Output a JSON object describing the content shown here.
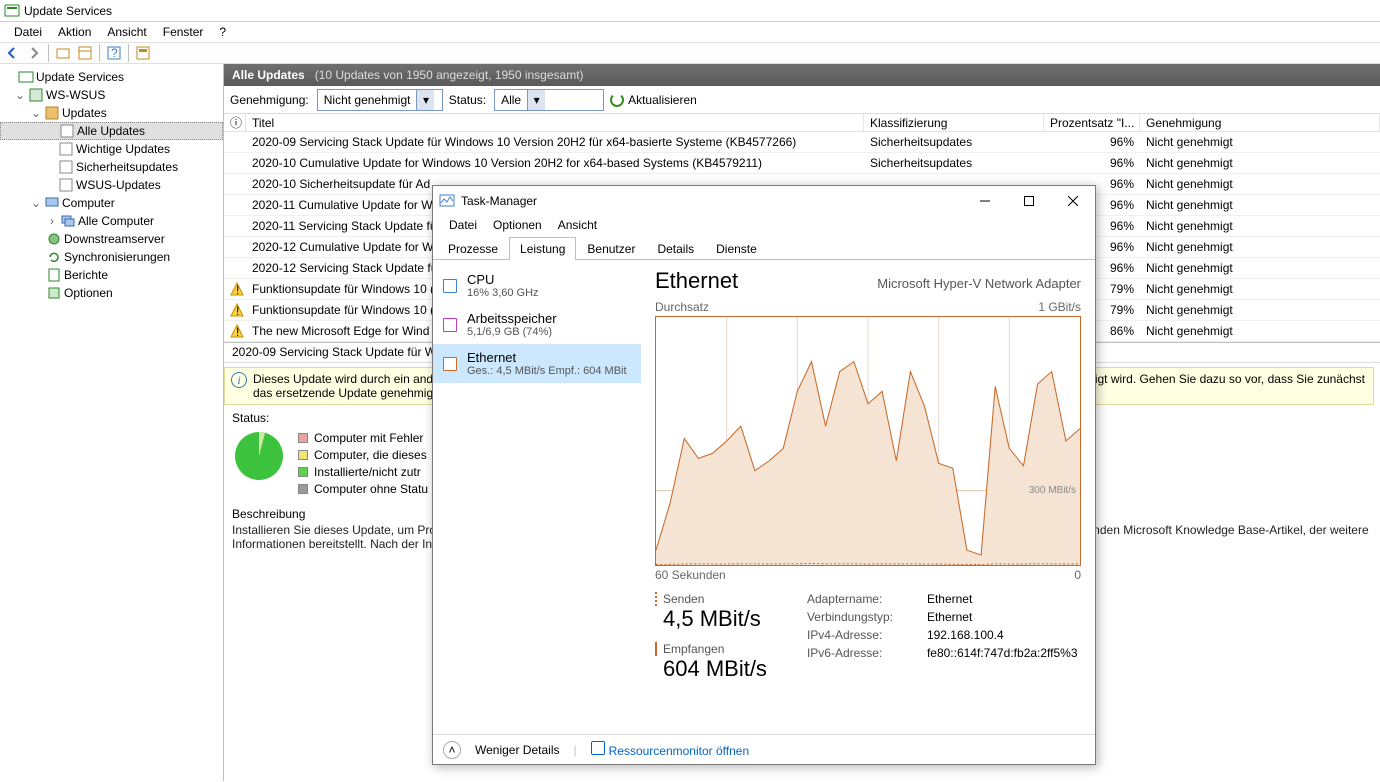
{
  "app": {
    "title": "Update Services"
  },
  "menubar": [
    "Datei",
    "Aktion",
    "Ansicht",
    "Fenster",
    "?"
  ],
  "tree": {
    "root": "Update Services",
    "server": "WS-WSUS",
    "updates": "Updates",
    "updates_children": [
      "Alle Updates",
      "Wichtige Updates",
      "Sicherheitsupdates",
      "WSUS-Updates"
    ],
    "computer": "Computer",
    "computer_children": [
      "Alle Computer"
    ],
    "other": [
      "Downstreamserver",
      "Synchronisierungen",
      "Berichte",
      "Optionen"
    ]
  },
  "content_header": {
    "title": "Alle Updates",
    "summary": "(10 Updates von 1950 angezeigt, 1950 insgesamt)"
  },
  "filter": {
    "approval_label": "Genehmigung:",
    "approval_value": "Nicht genehmigt",
    "status_label": "Status:",
    "status_value": "Alle",
    "refresh": "Aktualisieren"
  },
  "columns": [
    "",
    "Titel",
    "Klassifizierung",
    "Prozentsatz \"I...",
    "Genehmigung"
  ],
  "rows": [
    {
      "warn": false,
      "title": "2020-09 Servicing Stack Update für Windows 10 Version 20H2 für x64-basierte Systeme (KB4577266)",
      "class": "Sicherheitsupdates",
      "pct": "96%",
      "appr": "Nicht genehmigt"
    },
    {
      "warn": false,
      "title": "2020-10 Cumulative Update for Windows 10 Version 20H2 for x64-based Systems (KB4579211)",
      "class": "Sicherheitsupdates",
      "pct": "96%",
      "appr": "Nicht genehmigt"
    },
    {
      "warn": false,
      "title": "2020-10 Sicherheitsupdate für Ad",
      "class": "",
      "pct": "96%",
      "appr": "Nicht genehmigt"
    },
    {
      "warn": false,
      "title": "2020-11 Cumulative Update for W",
      "class": "",
      "pct": "96%",
      "appr": "Nicht genehmigt"
    },
    {
      "warn": false,
      "title": "2020-11 Servicing Stack Update fü",
      "class": "",
      "pct": "96%",
      "appr": "Nicht genehmigt"
    },
    {
      "warn": false,
      "title": "2020-12 Cumulative Update for W",
      "class": "",
      "pct": "96%",
      "appr": "Nicht genehmigt"
    },
    {
      "warn": false,
      "title": "2020-12 Servicing Stack Update fü",
      "class": "",
      "pct": "96%",
      "appr": "Nicht genehmigt"
    },
    {
      "warn": true,
      "title": "Funktionsupdate für Windows 10 (",
      "class": "",
      "pct": "79%",
      "appr": "Nicht genehmigt"
    },
    {
      "warn": true,
      "title": "Funktionsupdate für Windows 10 (",
      "class": "",
      "pct": "79%",
      "appr": "Nicht genehmigt"
    },
    {
      "warn": true,
      "title": "The new Microsoft Edge for Wind",
      "class": "",
      "pct": "86%",
      "appr": "Nicht genehmigt"
    }
  ],
  "detail": {
    "title": "2020-09 Servicing Stack Update für W",
    "info_text_1": "Dieses Update wird durch ein and",
    "info_text_2": "das ersetzende Update genehmig",
    "info_text_right": "igt wird. Gehen Sie dazu so vor, dass Sie zunächst",
    "status_label": "Status:",
    "legend": [
      {
        "color": "#e8a2a2",
        "label": "Computer mit Fehler"
      },
      {
        "color": "#f3e27b",
        "label": "Computer, die dieses"
      },
      {
        "color": "#5bd24b",
        "label": "Installierte/nicht zutr"
      },
      {
        "color": "#9a9a9a",
        "label": "Computer ohne Statu"
      }
    ],
    "desc_head": "Beschreibung",
    "desc_body": "Installieren Sie dieses Update, um Probleme in Windows zu beheben. Eine vollständige Liste der Problembehebungen in diesem Update finden Sie im entsprechenden Microsoft Knowledge Base-Artikel, der weitere Informationen bereitstellt. Nach der Installation dieser Komponente müssen Sie den Computer möglicherweise neu starten."
  },
  "tm": {
    "title": "Task-Manager",
    "menu": [
      "Datei",
      "Optionen",
      "Ansicht"
    ],
    "tabs": [
      "Prozesse",
      "Leistung",
      "Benutzer",
      "Details",
      "Dienste"
    ],
    "active_tab": 1,
    "side": [
      {
        "name": "CPU",
        "sub": "16%  3,60 GHz",
        "color": "#3a82d4"
      },
      {
        "name": "Arbeitsspeicher",
        "sub": "5,1/6,9 GB (74%)",
        "color": "#b93fbf"
      },
      {
        "name": "Ethernet",
        "sub": "Ges.: 4,5 MBit/s  Empf.: 604 MBit",
        "color": "#c86a2a"
      }
    ],
    "side_sel": 2,
    "eth_title": "Ethernet",
    "adapter": "Microsoft Hyper-V Network Adapter",
    "y_label": "Durchsatz",
    "y_max": "1 GBit/s",
    "grid_line_label": "300 MBit/s",
    "x_left": "60 Sekunden",
    "x_right": "0",
    "send_label": "Senden",
    "send_val": "4,5 MBit/s",
    "recv_label": "Empfangen",
    "recv_val": "604 MBit/s",
    "net": [
      {
        "k": "Adaptername:",
        "v": "Ethernet"
      },
      {
        "k": "Verbindungstyp:",
        "v": "Ethernet"
      },
      {
        "k": "IPv4-Adresse:",
        "v": "192.168.100.4"
      },
      {
        "k": "IPv6-Adresse:",
        "v": "fe80::614f:747d:fb2a:2ff5%3"
      }
    ],
    "footer_less": "Weniger Details",
    "footer_rm": "Ressourcenmonitor öffnen"
  },
  "chart_data": {
    "type": "line",
    "title": "Ethernet – Durchsatz",
    "xlabel": "Sekunden",
    "ylabel": "Durchsatz",
    "ylim": [
      0,
      1000
    ],
    "y_unit": "MBit/s",
    "x": [
      60,
      58,
      56,
      54,
      52,
      50,
      48,
      46,
      44,
      42,
      40,
      38,
      36,
      34,
      32,
      30,
      28,
      26,
      24,
      22,
      20,
      18,
      16,
      14,
      12,
      10,
      8,
      6,
      4,
      2,
      0
    ],
    "series": [
      {
        "name": "Empfangen",
        "values": [
          60,
          250,
          510,
          430,
          450,
          500,
          560,
          380,
          420,
          470,
          700,
          820,
          560,
          780,
          820,
          650,
          700,
          420,
          780,
          640,
          410,
          390,
          60,
          40,
          720,
          470,
          400,
          730,
          780,
          500,
          550
        ]
      },
      {
        "name": "Senden",
        "values": [
          2,
          3,
          4,
          5,
          4,
          4,
          5,
          5,
          4,
          5,
          5,
          6,
          5,
          5,
          5,
          4,
          5,
          4,
          5,
          4,
          4,
          3,
          2,
          2,
          5,
          4,
          4,
          5,
          5,
          4,
          5
        ]
      }
    ],
    "gridlines": [
      300
    ]
  }
}
